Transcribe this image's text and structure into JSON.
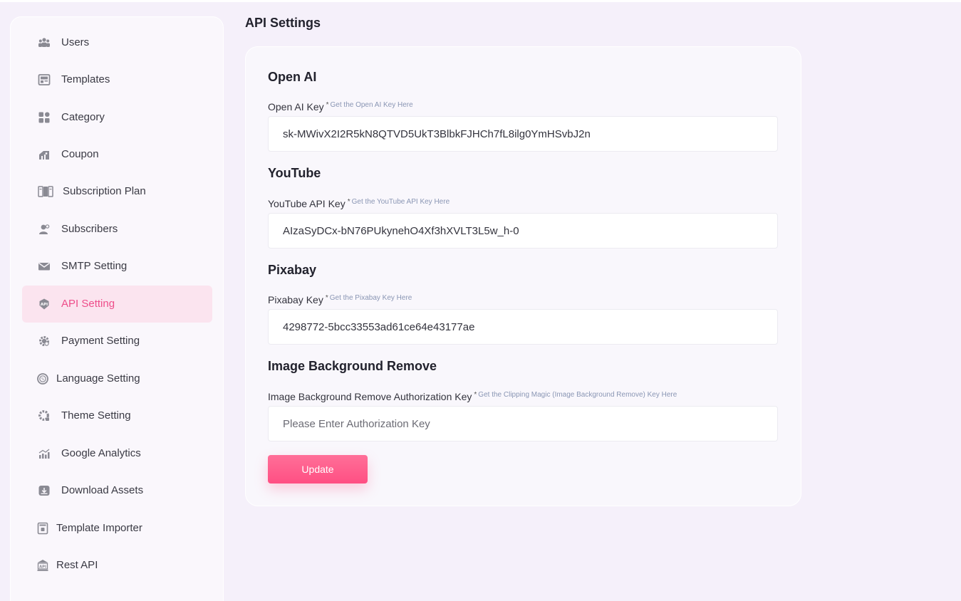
{
  "sidebar": {
    "items": [
      {
        "label": "Users",
        "icon": "users-icon"
      },
      {
        "label": "Templates",
        "icon": "templates-icon"
      },
      {
        "label": "Category",
        "icon": "category-icon"
      },
      {
        "label": "Coupon",
        "icon": "coupon-icon"
      },
      {
        "label": "Subscription Plan",
        "icon": "subscription-plan-icon"
      },
      {
        "label": "Subscribers",
        "icon": "subscribers-icon"
      },
      {
        "label": "SMTP Setting",
        "icon": "mail-icon"
      },
      {
        "label": "API Setting",
        "icon": "api-icon",
        "active": true
      },
      {
        "label": "Payment Setting",
        "icon": "payment-gear-icon"
      },
      {
        "label": "Language Setting",
        "icon": "language-icon"
      },
      {
        "label": "Theme Setting",
        "icon": "theme-gear-icon"
      },
      {
        "label": "Google Analytics",
        "icon": "analytics-icon"
      },
      {
        "label": "Download Assets",
        "icon": "download-icon"
      },
      {
        "label": "Template Importer",
        "icon": "template-importer-icon"
      },
      {
        "label": "Rest API",
        "icon": "rest-api-icon"
      }
    ]
  },
  "page": {
    "title": "API Settings"
  },
  "sections": {
    "openai": {
      "title": "Open AI",
      "label": "Open AI Key",
      "required": "*",
      "help": "Get the Open AI Key Here",
      "value": "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"
    },
    "youtube": {
      "title": "YouTube",
      "label": "YouTube API Key",
      "required": "*",
      "help": "Get the YouTube API Key Here",
      "value": "AIzaSyDCx-bN76PUkynehO4Xf3hXVLT3L5w_h-0"
    },
    "pixabay": {
      "title": "Pixabay",
      "label": "Pixabay Key",
      "required": "*",
      "help": "Get the Pixabay Key Here",
      "value": "4298772-5bcc33553ad61ce64e43177ae"
    },
    "bgremove": {
      "title": "Image Background Remove",
      "label": "Image Background Remove Authorization Key",
      "required": "*",
      "help": "Get the Clipping Magic (Image Background Remove) Key Here",
      "value": "",
      "placeholder": "Please Enter Authorization Key"
    }
  },
  "actions": {
    "update_label": "Update"
  },
  "colors": {
    "accent": "#ee4d8a",
    "button": "#ff5c8d",
    "background": "#f5f0fa"
  }
}
